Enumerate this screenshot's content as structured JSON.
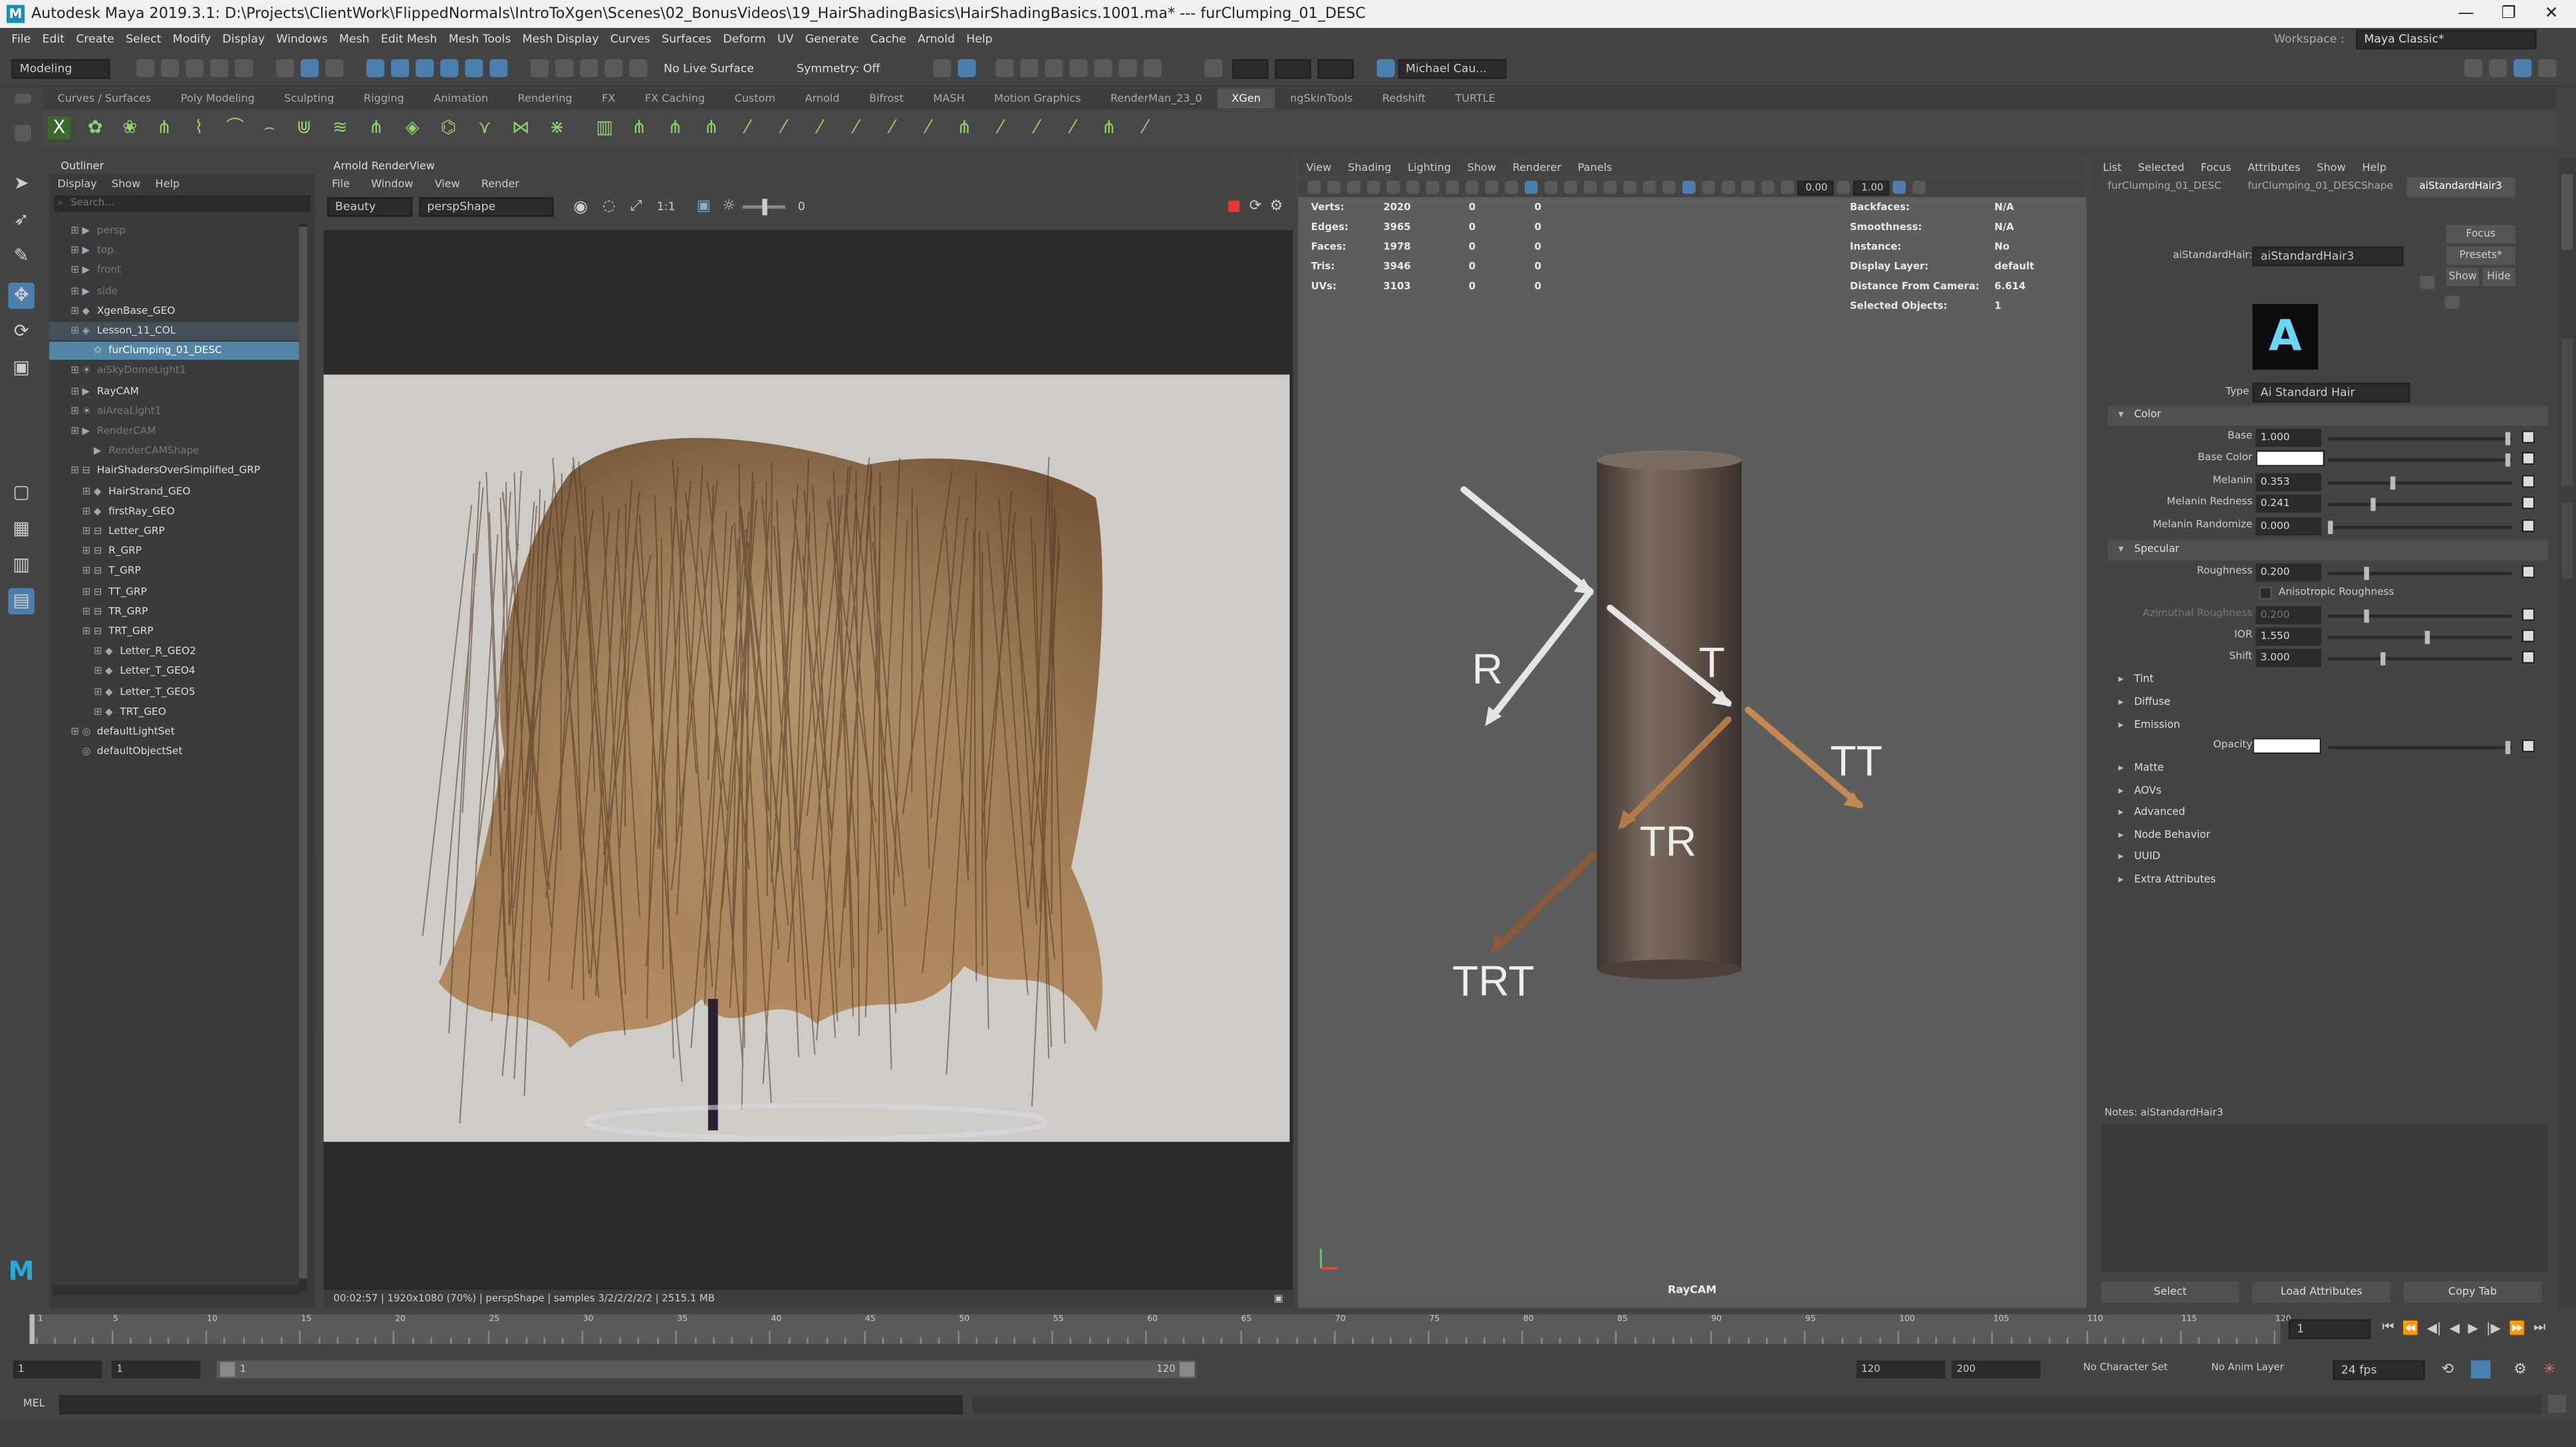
{
  "title": "Autodesk Maya 2019.3.1: D:\\Projects\\ClientWork\\FlippedNormals\\IntroToXgen\\Scenes\\02_BonusVideos\\19_HairShadingBasics\\HairShadingBasics.1001.ma*  ---  furClumping_01_DESC",
  "window_controls": [
    "—",
    "❐",
    "✕"
  ],
  "menu": [
    "File",
    "Edit",
    "Create",
    "Select",
    "Modify",
    "Display",
    "Windows",
    "Mesh",
    "Edit Mesh",
    "Mesh Tools",
    "Mesh Display",
    "Curves",
    "Surfaces",
    "Deform",
    "UV",
    "Generate",
    "Cache",
    "Arnold",
    "Help"
  ],
  "workspace": {
    "label": "Workspace :",
    "value": "Maya Classic*"
  },
  "status": {
    "mode": "Modeling",
    "live_surface": "No Live Surface",
    "symmetry": "Symmetry: Off",
    "user": "Michael Cau..."
  },
  "shelf_tabs": [
    "Curves / Surfaces",
    "Poly Modeling",
    "Sculpting",
    "Rigging",
    "Animation",
    "Rendering",
    "FX",
    "FX Caching",
    "Custom",
    "Arnold",
    "Bifrost",
    "MASH",
    "Motion Graphics",
    "RenderMan_23_0",
    "XGen",
    "ngSkinTools",
    "Redshift",
    "TURTLE"
  ],
  "shelf_active": "XGen",
  "outliner": {
    "title": "Outliner",
    "menu": [
      "Display",
      "Show",
      "Help"
    ],
    "search_placeholder": "Search...",
    "items": [
      {
        "label": "persp",
        "dim": true
      },
      {
        "label": "top",
        "dim": true
      },
      {
        "label": "front",
        "dim": true
      },
      {
        "label": "side",
        "dim": true
      },
      {
        "label": "XgenBase_GEO",
        "dim": false
      },
      {
        "label": "Lesson_11_COL",
        "dim": false
      },
      {
        "label": "furClumping_01_DESC",
        "dim": false
      },
      {
        "label": "aiSkyDomeLight1",
        "dim": true
      },
      {
        "label": "RayCAM",
        "dim": false
      },
      {
        "label": "aiAreaLight1",
        "dim": true
      },
      {
        "label": "RenderCAM",
        "dim": true
      },
      {
        "label": "RenderCAMShape",
        "dim": true
      },
      {
        "label": "HairShadersOverSimplified_GRP",
        "dim": false
      },
      {
        "label": "HairStrand_GEO",
        "dim": false
      },
      {
        "label": "firstRay_GEO",
        "dim": false
      },
      {
        "label": "Letter_GRP",
        "dim": false
      },
      {
        "label": "R_GRP",
        "dim": false
      },
      {
        "label": "T_GRP",
        "dim": false
      },
      {
        "label": "TT_GRP",
        "dim": false
      },
      {
        "label": "TR_GRP",
        "dim": false
      },
      {
        "label": "TRT_GRP",
        "dim": false
      },
      {
        "label": "Letter_R_GEO2",
        "dim": false
      },
      {
        "label": "Letter_T_GEO4",
        "dim": false
      },
      {
        "label": "Letter_T_GEO5",
        "dim": false
      },
      {
        "label": "TRT_GEO",
        "dim": false
      },
      {
        "label": "defaultLightSet",
        "dim": false
      },
      {
        "label": "defaultObjectSet",
        "dim": false
      }
    ]
  },
  "renderview": {
    "title": "Arnold RenderView",
    "menu": [
      "File",
      "Window",
      "View",
      "Render"
    ],
    "aov": "Beauty",
    "camera": "perspShape",
    "ratio": "1:1",
    "exposure": "0",
    "status": "00:02:57 | 1920x1080 (70%) | perspShape | samples 3/2/2/2/2/2 | 2515.1 MB"
  },
  "viewport": {
    "menu": [
      "View",
      "Shading",
      "Lighting",
      "Show",
      "Renderer",
      "Panels"
    ],
    "field1": "0.00",
    "field2": "1.00",
    "hud_left": [
      {
        "k": "Verts:",
        "a": "2020",
        "b": "0",
        "c": "0"
      },
      {
        "k": "Edges:",
        "a": "3965",
        "b": "0",
        "c": "0"
      },
      {
        "k": "Faces:",
        "a": "1978",
        "b": "0",
        "c": "0"
      },
      {
        "k": "Tris:",
        "a": "3946",
        "b": "0",
        "c": "0"
      },
      {
        "k": "UVs:",
        "a": "3103",
        "b": "0",
        "c": "0"
      }
    ],
    "hud_right": [
      {
        "k": "Backfaces:",
        "v": "N/A"
      },
      {
        "k": "Smoothness:",
        "v": "N/A"
      },
      {
        "k": "Instance:",
        "v": "No"
      },
      {
        "k": "Display Layer:",
        "v": "default"
      },
      {
        "k": "Distance From Camera:",
        "v": "6.614"
      },
      {
        "k": "Selected Objects:",
        "v": "1"
      }
    ],
    "labels": {
      "r": "R",
      "t": "T",
      "tt": "TT",
      "tr": "TR",
      "trt": "TRT"
    },
    "camera_name": "RayCAM"
  },
  "attr": {
    "menu": [
      "List",
      "Selected",
      "Focus",
      "Attributes",
      "Show",
      "Help"
    ],
    "tabs": [
      "furClumping_01_DESC",
      "furClumping_01_DESCShape",
      "aiStandardHair3"
    ],
    "node_label": "aiStandardHair:",
    "node_name": "aiStandardHair3",
    "buttons": {
      "focus": "Focus",
      "presets": "Presets*",
      "show": "Show",
      "hide": "Hide"
    },
    "type_label": "Type",
    "type_value": "Ai Standard Hair",
    "sections": {
      "color": "Color",
      "specular": "Specular",
      "tint": "Tint",
      "diffuse": "Diffuse",
      "emission": "Emission",
      "matte": "Matte",
      "aovs": "AOVs",
      "advanced": "Advanced",
      "node_behavior": "Node Behavior",
      "uuid": "UUID",
      "extra": "Extra Attributes"
    },
    "color_rows": [
      {
        "label": "Base",
        "value": "1.000",
        "level": 1.0
      },
      {
        "label": "Base Color",
        "value": "",
        "level": 1.0
      },
      {
        "label": "Melanin",
        "value": "0.353",
        "level": 0.353
      },
      {
        "label": "Melanin Redness",
        "value": "0.241",
        "level": 0.241
      },
      {
        "label": "Melanin Randomize",
        "value": "0.000",
        "level": 0.0
      }
    ],
    "spec_rows": [
      {
        "label": "Roughness",
        "value": "0.200",
        "level": 0.2
      },
      {
        "label": "Anisotropic Roughness",
        "value": "",
        "level": 0
      },
      {
        "label": "Azimuthal Roughness",
        "value": "0.200",
        "level": 0.2
      },
      {
        "label": "IOR",
        "value": "1.550",
        "level": 0.55
      },
      {
        "label": "Shift",
        "value": "3.000",
        "level": 0.3
      }
    ],
    "opacity_label": "Opacity",
    "notes": "Notes: aiStandardHair3",
    "bottom_buttons": [
      "Select",
      "Load Attributes",
      "Copy Tab"
    ]
  },
  "timeline": {
    "ticks": [
      "1",
      "5",
      "10",
      "15",
      "20",
      "25",
      "30",
      "35",
      "40",
      "45",
      "50",
      "55",
      "60",
      "65",
      "70",
      "75",
      "80",
      "85",
      "90",
      "95",
      "100",
      "105",
      "110",
      "115",
      "120"
    ],
    "current_frame": "1"
  },
  "range": {
    "start": "1",
    "start2": "1",
    "slider_start": "1",
    "slider_end": "120",
    "end": "120",
    "end2": "200",
    "character_set": "No Character Set",
    "anim_layer": "No Anim Layer",
    "fps": "24 fps"
  },
  "cmdline": {
    "lang": "MEL"
  }
}
